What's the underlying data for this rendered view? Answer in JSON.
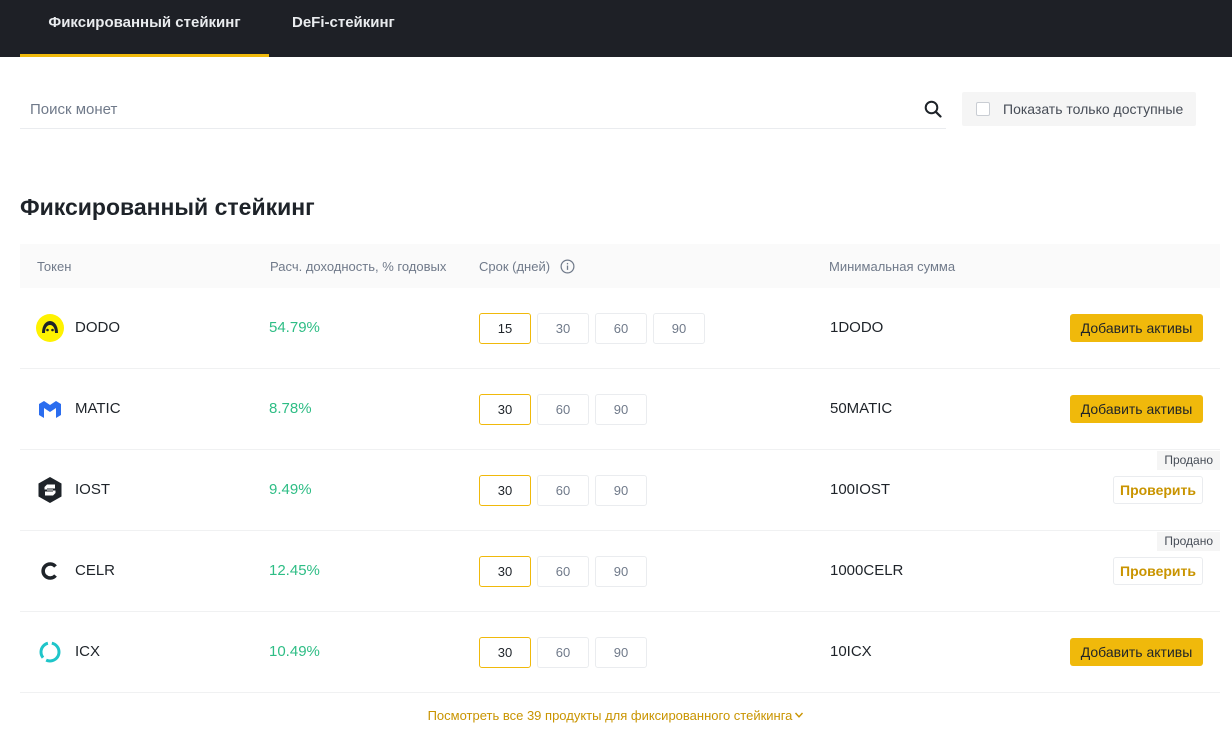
{
  "tabs": [
    {
      "label": "Фиксированный стейкинг",
      "active": true
    },
    {
      "label": "DeFi-стейкинг",
      "active": false
    }
  ],
  "search": {
    "placeholder": "Поиск монет",
    "value": ""
  },
  "filter": {
    "label": "Показать только доступные",
    "checked": false
  },
  "section_title": "Фиксированный стейкинг",
  "table": {
    "headers": {
      "token": "Токен",
      "apy": "Расч. доходность, % годовых",
      "term": "Срок (дней)",
      "min": "Минимальная сумма"
    },
    "rows": [
      {
        "name": "DODO",
        "icon": "dodo-icon",
        "apy": "54.79%",
        "terms": [
          "15",
          "30",
          "60",
          "90"
        ],
        "active_term": "15",
        "min": "1DODO",
        "action": "Добавить активы",
        "sold": ""
      },
      {
        "name": "MATIC",
        "icon": "matic-icon",
        "apy": "8.78%",
        "terms": [
          "30",
          "60",
          "90"
        ],
        "active_term": "30",
        "min": "50MATIC",
        "action": "Добавить активы",
        "sold": ""
      },
      {
        "name": "IOST",
        "icon": "iost-icon",
        "apy": "9.49%",
        "terms": [
          "30",
          "60",
          "90"
        ],
        "active_term": "30",
        "min": "100IOST",
        "action": "Проверить",
        "sold": "Продано"
      },
      {
        "name": "CELR",
        "icon": "celr-icon",
        "apy": "12.45%",
        "terms": [
          "30",
          "60",
          "90"
        ],
        "active_term": "30",
        "min": "1000CELR",
        "action": "Проверить",
        "sold": "Продано"
      },
      {
        "name": "ICX",
        "icon": "icx-icon",
        "apy": "10.49%",
        "terms": [
          "30",
          "60",
          "90"
        ],
        "active_term": "30",
        "min": "10ICX",
        "action": "Добавить активы",
        "sold": ""
      }
    ]
  },
  "view_all": "Посмотреть все 39 продукты для фиксированного стейкинга",
  "colors": {
    "accent": "#f0b90b",
    "apy_green": "#2ebd85",
    "link_gold": "#c99400",
    "topbar": "#1e2026"
  }
}
